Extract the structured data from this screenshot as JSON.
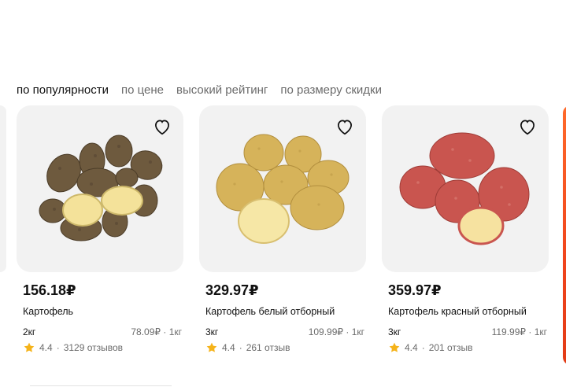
{
  "sort": {
    "options": [
      "по популярности",
      "по цене",
      "высокий рейтинг",
      "по размеру скидки"
    ],
    "active_index": 0
  },
  "products": [
    {
      "price": "156.18₽",
      "name": "Картофель",
      "weight": "2кг",
      "per_unit": "78.09₽ · 1кг",
      "rating": "4.4",
      "reviews": "3129 отзывов",
      "image_icon": "brown-potatoes"
    },
    {
      "price": "329.97₽",
      "name": "Картофель белый отборный",
      "weight": "3кг",
      "per_unit": "109.99₽ · 1кг",
      "rating": "4.4",
      "reviews": "261 отзыв",
      "image_icon": "yellow-potatoes"
    },
    {
      "price": "359.97₽",
      "name": "Картофель красный отборный",
      "weight": "3кг",
      "per_unit": "119.99₽ · 1кг",
      "rating": "4.4",
      "reviews": "201 отзыв",
      "image_icon": "red-potatoes"
    }
  ],
  "colors": {
    "star": "#f5b31a",
    "card_bg": "#f2f2f2",
    "brown_potato": "#6e5a3e",
    "yellow_potato": "#d6b35a",
    "red_potato": "#c9554f",
    "flesh": "#f4e29a",
    "accent": "#f0441c"
  }
}
